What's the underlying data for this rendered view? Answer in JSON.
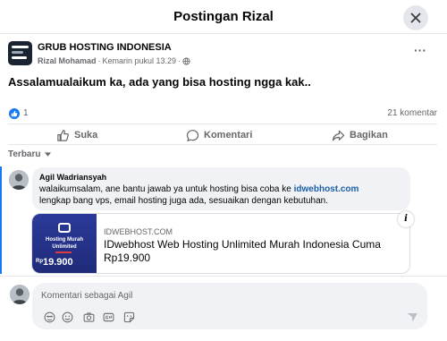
{
  "dialog": {
    "title": "Postingan Rizal"
  },
  "post": {
    "group_name": "GRUB HOSTING INDONESIA",
    "author": "Rizal Mohamad",
    "separator": "·",
    "time": "Kemarin pukul 13.29",
    "audience_icon": "globe-icon",
    "text": "Assalamualaikum ka, ada yang bisa hosting ngga kak.."
  },
  "reactions": {
    "like_count": "1",
    "comment_count": "21 komentar"
  },
  "actions": {
    "like": "Suka",
    "comment": "Komentari",
    "share": "Bagikan"
  },
  "sort": {
    "label": "Terbaru"
  },
  "comment": {
    "name": "Agil Wadriansyah",
    "text_before": "walaikumsalam, ane bantu jawab ya untuk hosting bisa coba ke ",
    "link": "idwebhost.com",
    "text_after": "lengkap bang vps, email hosting juga ada, sesuaikan dengan kebutuhan."
  },
  "link_preview": {
    "thumb_line1": "Hosting Murah",
    "thumb_line2": "Unlimited",
    "thumb_price_prefix": "Rp",
    "thumb_price": "19.900",
    "domain": "IDWEBHOST.COM",
    "title": "IDwebhost Web Hosting Unlimited Murah Indonesia Cuma Rp19.900",
    "info_label": "i"
  },
  "composer": {
    "placeholder": "Komentari sebagai Agil",
    "tools": [
      "avatar-sticker-icon",
      "emoji-icon",
      "camera-icon",
      "gif-icon",
      "sticker-icon"
    ],
    "send_icon": "send-icon"
  },
  "colors": {
    "accent": "#1877f2",
    "link": "#1a5fa8",
    "muted": "#65676b",
    "bubble": "#f0f2f5",
    "divider": "#e4e6eb"
  }
}
